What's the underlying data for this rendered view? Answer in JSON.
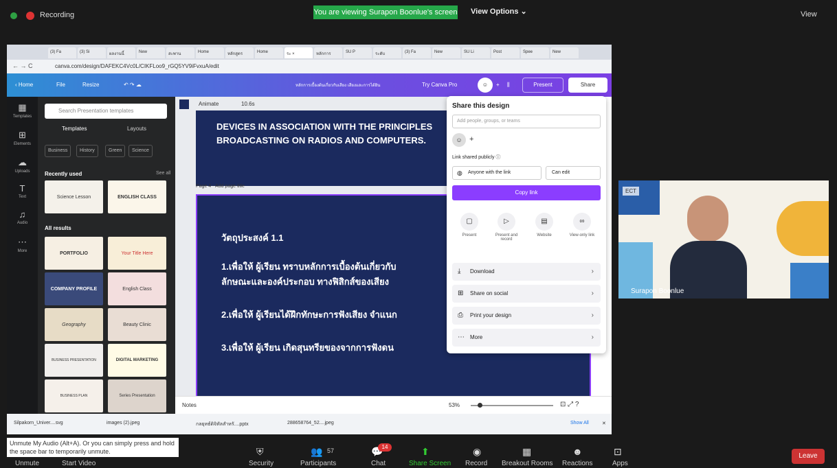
{
  "zoom_top": {
    "recording": "Recording",
    "viewing": "You are viewing Surapon Boonlue's screen",
    "view_options": "View Options ⌄",
    "view": "View"
  },
  "browser": {
    "url": "canva.com/design/DAFEKC4Vc0L/CIKFLoo9_rGQ5YV9iFvxuA/edit",
    "tabs": [
      "(3) Fa",
      "(3) Si",
      "ผลงานนี้",
      "New",
      "สะพาน",
      "Home",
      "หลักสูตร",
      "Home",
      "ระ ×",
      "หลักการ",
      "SU P",
      "ระดับ",
      "(3) Fa",
      "New",
      "SU Li",
      "Post",
      "Spee",
      "New"
    ]
  },
  "canva_bar": {
    "home": "‹ Home",
    "file": "File",
    "resize": "Resize",
    "doc_title": "หลักการเบื้องต้นเกี่ยวกับเสียง เสียงและการได้ยิน",
    "try_pro": "Try Canva Pro",
    "present": "Present",
    "share": "Share"
  },
  "rail": [
    {
      "icon": "▦",
      "label": "Templates"
    },
    {
      "icon": "⊞",
      "label": "Elements"
    },
    {
      "icon": "☁",
      "label": "Uploads"
    },
    {
      "icon": "T",
      "label": "Text"
    },
    {
      "icon": "♫",
      "label": "Audio"
    },
    {
      "icon": "⋯",
      "label": "More"
    }
  ],
  "left_panel": {
    "search_placeholder": "Search Presentation templates",
    "tabs": [
      "Templates",
      "Layouts"
    ],
    "chips": [
      "Business",
      "History",
      "Green",
      "Science"
    ],
    "recently_used": "Recently used",
    "see_all": "See all",
    "all_results": "All results",
    "thumbs": [
      "Science Lesson",
      "ENGLISH CLASS",
      "PORTFOLIO",
      "Your Title Here",
      "COMPANY PROFILE",
      "English Class",
      "Geography",
      "Beauty Clinic",
      "BUSINESS PRESENTATION",
      "DIGITAL MARKETING",
      "BUSINESS PLAN",
      "Series Presentation"
    ]
  },
  "editor": {
    "animate": "Animate",
    "duration": "10.6s",
    "slide3_text": "DEVICES IN ASSOCIATION WITH THE PRINCIPLES BROADCASTING ON RADIOS AND COMPUTERS.",
    "page4_label": "Page 4 - Add page title",
    "slide4_lines": [
      "วัตถุประสงค์ 1.1",
      "1.เพื่อให้ ผู้เรียน ทราบหลักการเบื้องต้นเกี่ยวกับ",
      "ลักษณะและองค์ประกอบ ทางฟิสิกส์ของเสียง",
      "2.เพื่อให้ ผู้เรียนได้ฝึกทักษะการฟังเสียง จำแนก",
      "3.เพื่อให้ ผู้เรียน เกิดสุนทรียของจากการฟังดน"
    ],
    "notes": "Notes",
    "zoom": "53%"
  },
  "share_panel": {
    "title": "Share this design",
    "placeholder": "Add people, groups, or teams",
    "link_label": "Link shared publicly ⓘ",
    "anyone": "Anyone with the link",
    "can_edit": "Can edit",
    "copy_link": "Copy link",
    "options": [
      "Present",
      "Present and record",
      "Website",
      "View-only link"
    ],
    "rows": [
      {
        "icon": "⤓",
        "label": "Download"
      },
      {
        "icon": "⊞",
        "label": "Share on social"
      },
      {
        "icon": "⎙",
        "label": "Print your design"
      },
      {
        "icon": "⋯",
        "label": "More"
      }
    ]
  },
  "downloads": {
    "items": [
      "Silpakorn_Univer....svg",
      "images (2).jpeg",
      "กลยุทธ์ดิจิทัลสำหรั....pptx",
      "288658764_52....jpeg"
    ],
    "show_all": "Show All"
  },
  "speaker": {
    "name": "Surapon Boonlue",
    "badge": "ECT"
  },
  "toolbar": {
    "tip": "Unmute My Audio (Alt+A). Or you can simply press and hold the space bar to temporarily unmute.",
    "unmute": "Unmute",
    "start_video": "Start Video",
    "security": "Security",
    "participants": "Participants",
    "participants_count": "57",
    "chat": "Chat",
    "chat_badge": "14",
    "share_screen": "Share Screen",
    "record": "Record",
    "breakout": "Breakout Rooms",
    "reactions": "Reactions",
    "apps": "Apps",
    "leave": "Leave"
  },
  "colors": {
    "canva_purple": "#8b3dff",
    "slide_navy": "#1b2a5e",
    "zoom_green": "#26a84a",
    "leave_red": "#c33"
  }
}
